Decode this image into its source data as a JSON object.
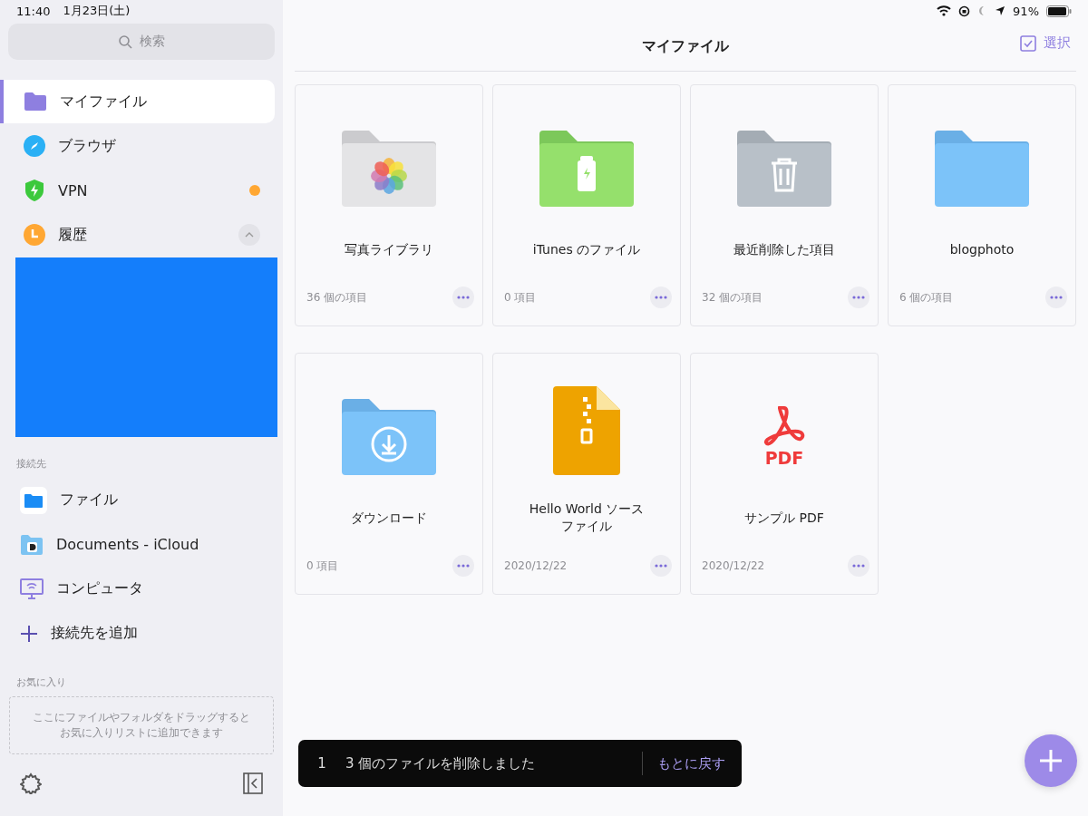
{
  "status_bar": {
    "time": "11:40",
    "date": "1月23日(土)",
    "battery": "91%"
  },
  "sidebar": {
    "search": {
      "placeholder": "検索"
    },
    "items": [
      {
        "kind": "folder",
        "label": "マイファイル",
        "selected": true
      },
      {
        "kind": "compass",
        "label": "ブラウザ",
        "selected": false
      },
      {
        "kind": "shield",
        "label": "VPN",
        "selected": false,
        "color": "#ffa733"
      },
      {
        "kind": "clock",
        "label": "履歴",
        "selected": false,
        "expanded": true
      }
    ],
    "connections_heading": "接続先",
    "connections": [
      {
        "kind": "files",
        "label": "ファイル"
      },
      {
        "kind": "documents",
        "label": "Documents - iCloud"
      },
      {
        "kind": "computer",
        "label": "コンピュータ"
      },
      {
        "kind": "add",
        "label": "接続先を追加"
      }
    ],
    "favorites_heading": "お気に入り",
    "favorites_hint": "ここにファイルやフォルダをドラッグするとお気に入りリストに追加できます"
  },
  "header": {
    "title": "マイファイル",
    "select": "選択"
  },
  "items": [
    {
      "kind": "photos",
      "name": "写真ライブラリ",
      "meta": "36 個の項目"
    },
    {
      "kind": "usb",
      "name": "iTunes のファイル",
      "meta": "0 項目"
    },
    {
      "kind": "trash",
      "name": "最近削除した項目",
      "meta": "32 個の項目"
    },
    {
      "kind": "folder",
      "name": "blogphoto",
      "meta": "6 個の項目"
    },
    {
      "kind": "download",
      "name": "ダウンロード",
      "meta": "0 項目"
    },
    {
      "kind": "zip",
      "name": "Hello World ソースファイル",
      "meta": "2020/12/22"
    },
    {
      "kind": "pdf",
      "name": "サンプル PDF",
      "meta": "2020/12/22",
      "badge": "PDF"
    }
  ],
  "toast": {
    "count": "1",
    "message": "3 個のファイルを削除しました",
    "action": "もとに戻す"
  }
}
